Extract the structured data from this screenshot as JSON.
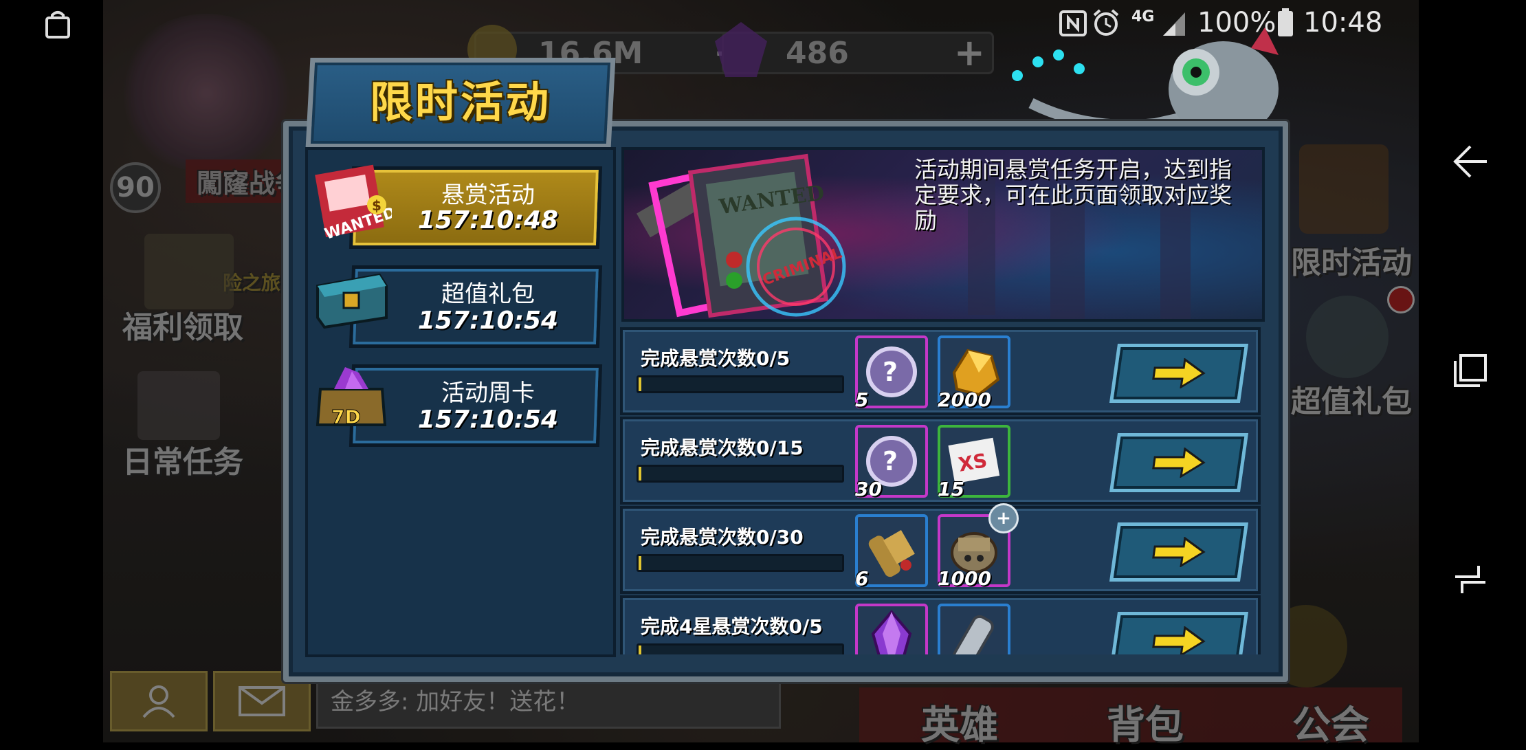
{
  "status_bar": {
    "battery": "100%",
    "time": "10:48",
    "network": "4G"
  },
  "background": {
    "gold_amount": "16.6M",
    "gem_amount": "486",
    "level": "90",
    "left_menu": [
      "闖窿战争",
      "福利领取",
      "日常任务"
    ],
    "left_menu_partial": "险之旅",
    "right_menu": [
      "限时活动",
      "超值礼包"
    ],
    "bottom_tabs": [
      "英雄",
      "背包",
      "公会"
    ],
    "chat_message": "金多多: 加好友！送花！"
  },
  "dialog": {
    "title": "限时活动",
    "tabs": [
      {
        "label": "悬赏活动",
        "timer": "157:10:48",
        "active": true,
        "badge": "WANTED"
      },
      {
        "label": "超值礼包",
        "timer": "157:10:54",
        "active": false,
        "badge": ""
      },
      {
        "label": "活动周卡",
        "timer": "157:10:54",
        "active": false,
        "badge": "7D"
      }
    ],
    "banner_text": "活动期间悬赏任务开启，达到指定要求，可在此页面领取对应奖励",
    "banner_sign": "WANTED",
    "banner_stamp": "CRIMINAL",
    "rows": [
      {
        "label": "完成悬赏次数0/5",
        "progress": 0,
        "rewards": [
          {
            "count": "5",
            "icon": "mystery-token-icon"
          },
          {
            "count": "2000",
            "icon": "gold-ore-icon"
          }
        ]
      },
      {
        "label": "完成悬赏次数0/15",
        "progress": 0,
        "rewards": [
          {
            "count": "30",
            "icon": "mystery-token-icon"
          },
          {
            "count": "15",
            "icon": "xs-ticket-icon"
          }
        ]
      },
      {
        "label": "完成悬赏次数0/30",
        "progress": 0,
        "rewards": [
          {
            "count": "6",
            "icon": "scroll-icon"
          },
          {
            "count": "1000",
            "icon": "mech-fragment-icon"
          }
        ]
      },
      {
        "label": "完成4星悬赏次数0/5",
        "progress": 0,
        "rewards": [
          {
            "count": "",
            "icon": "purple-crystal-icon"
          },
          {
            "count": "",
            "icon": "silver-item-icon"
          }
        ]
      }
    ]
  },
  "colors": {
    "title_gold": "#ffd84a",
    "active_tab": "#b08a1a",
    "dialog_bg": "#1f3a52",
    "arrow_yellow": "#f5d423"
  }
}
